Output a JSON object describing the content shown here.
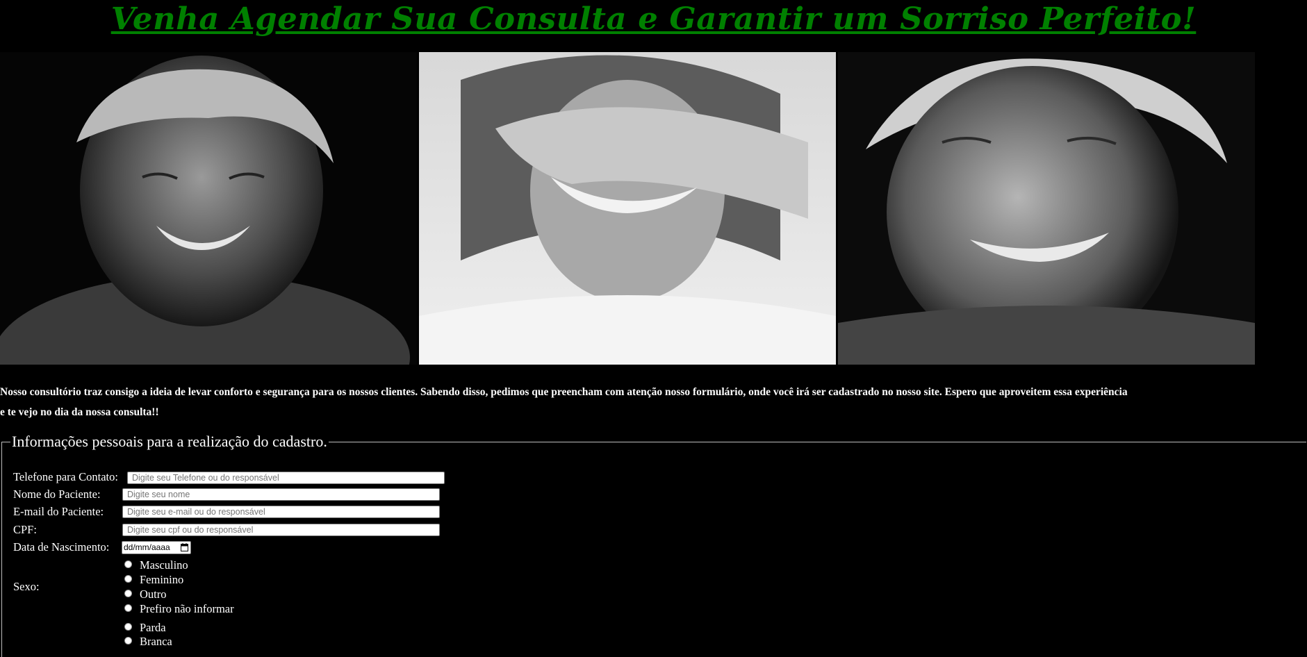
{
  "header": {
    "title": "Venha Agendar Sua Consulta e Garantir um Sorriso Perfeito!"
  },
  "intro": {
    "line1": "Nosso consultório traz consigo a ideia de levar conforto e segurança para os nossos clientes. Sabendo disso, pedimos que preencham com atenção nosso formulário, onde você irá ser cadastrado no nosso site. Espero que aproveitem essa experiência",
    "line2": "e te vejo no dia da nossa consulta!!"
  },
  "form": {
    "legend": "Informações pessoais para a realização do cadastro.",
    "phone": {
      "label": "Telefone para Contato:",
      "placeholder": "Digite seu Telefone ou do responsável"
    },
    "name": {
      "label": "Nome do Paciente:",
      "placeholder": "Digite seu nome"
    },
    "email": {
      "label": "E-mail do Paciente:",
      "placeholder": "Digite seu e-mail ou do responsável"
    },
    "cpf": {
      "label": "CPF:",
      "placeholder": "Digite seu cpf ou do responsável"
    },
    "birth": {
      "label": "Data de Nascimento:",
      "value": "dd/mm/aaaa"
    },
    "sex": {
      "label": "Sexo:",
      "options": [
        "Masculino",
        "Feminino",
        "Outro",
        "Prefiro não informar"
      ]
    },
    "race": {
      "options": [
        "Parda",
        "Branca"
      ]
    }
  },
  "colors": {
    "title": "#008000",
    "background": "#000000",
    "text": "#ffffff"
  },
  "icons": {
    "calendar": "calendar-icon"
  }
}
